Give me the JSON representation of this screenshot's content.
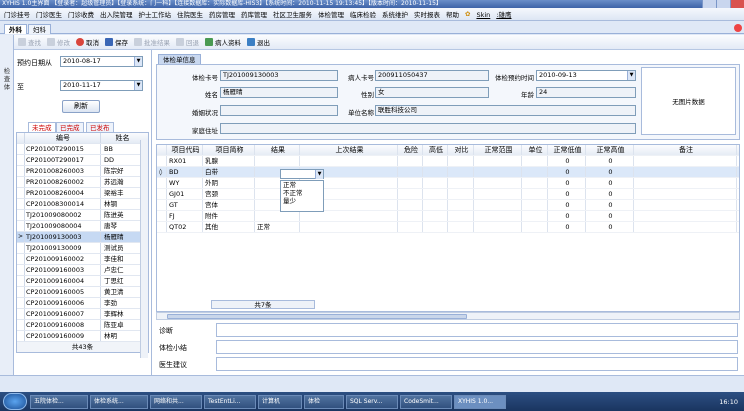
{
  "window": {
    "title": "XYHIS 1.0主界面 【登录者：超级管理员】【登录系统：门一科】【连接数据库：实际数据库-HIS3】【系统时间：2010-11-15 19:13:45】【版本时间：2010-11-15】"
  },
  "menu": [
    "门诊挂号",
    "门诊医生",
    "门诊收费",
    "出入院管理",
    "护士工作站",
    "住院医生",
    "药房管理",
    "药库管理",
    "社区卫生服务",
    "体检管理",
    "临床检验",
    "系统维护",
    "实时报表",
    "帮助",
    "Skin"
  ],
  "menu_skin_value": "雄鹰",
  "tabs": [
    "外科",
    "妇科"
  ],
  "toolbar": {
    "search": "查找",
    "modify": "修改",
    "cancel": "取消",
    "save": "保存",
    "batch": "批准结果",
    "back": "回退",
    "patient": "病人资料",
    "exit": "退出"
  },
  "sidebar_vertical": "检查体",
  "left": {
    "date_from_label": "预约日期从",
    "date_from": "2010-08-17",
    "date_to_label": "至",
    "date_to": "2010-11-17",
    "refresh": "刷新",
    "subtabs": [
      "未完成",
      "已完成",
      "已发布"
    ],
    "col_code": "编号",
    "col_name": "姓名",
    "rows": [
      [
        "CP20100T290015",
        "BB"
      ],
      [
        "CP20100T290017",
        "DD"
      ],
      [
        "PR201008260003",
        "陈宗好"
      ],
      [
        "PR201008260002",
        "苏远瀚"
      ],
      [
        "PR201008260004",
        "梁裕丰"
      ],
      [
        "CP201008300014",
        "林钢"
      ],
      [
        "TJ201009080002",
        "陈进英"
      ],
      [
        "TJ201009080004",
        "唐琴"
      ],
      [
        "TJ201009130003",
        "杨雁晴"
      ],
      [
        "TJ201009130009",
        "测试员"
      ],
      [
        "CP201009160002",
        "李佳和"
      ],
      [
        "CP201009160003",
        "卢忠仁"
      ],
      [
        "CP201009160004",
        "丁思红"
      ],
      [
        "CP201009160005",
        "黄卫清"
      ],
      [
        "CP201009160006",
        "李劲"
      ],
      [
        "CP201009160007",
        "李辉林"
      ],
      [
        "CP201009160008",
        "陈亚卓"
      ],
      [
        "CP201009160009",
        "林明"
      ]
    ],
    "selected_index": 8,
    "total": "共43条"
  },
  "info": {
    "tab": "体检单信息",
    "card_label": "体检卡号",
    "card": "TJ201009130003",
    "patient_no_label": "病人卡号",
    "patient_no": "200911050437",
    "appt_label": "体检预约时间",
    "appt": "2010-09-13",
    "name_label": "姓名",
    "name": "杨雁晴",
    "sex_label": "性别",
    "sex": "女",
    "age_label": "年龄",
    "age": "24",
    "marital_label": "婚姻状况",
    "marital": "",
    "unit_label": "单位名称",
    "unit": "联胜科技公司",
    "address_label": "家庭住址",
    "address": "",
    "photo": "无图片数据"
  },
  "detail": {
    "headers": [
      "项目代码",
      "项目简称",
      "结果",
      "上次结果",
      "危险",
      "高低",
      "对比",
      "正常范围",
      "单位",
      "正常低值",
      "正常高值",
      "备注"
    ],
    "rows": [
      [
        "RX01",
        "乳腺",
        "",
        "",
        "",
        "",
        "",
        "",
        "",
        "0",
        "0",
        ""
      ],
      [
        "BD",
        "白带",
        "",
        "",
        "",
        "",
        "",
        "",
        "",
        "0",
        "0",
        ""
      ],
      [
        "WY",
        "外阴",
        "",
        "",
        "",
        "",
        "",
        "",
        "",
        "0",
        "0",
        ""
      ],
      [
        "GJ01",
        "宫颈",
        "",
        "",
        "",
        "",
        "",
        "",
        "",
        "0",
        "0",
        ""
      ],
      [
        "GT",
        "宫体",
        "",
        "",
        "",
        "",
        "",
        "",
        "",
        "0",
        "0",
        ""
      ],
      [
        "FJ",
        "附件",
        "",
        "",
        "",
        "",
        "",
        "",
        "",
        "0",
        "0",
        ""
      ],
      [
        "QT02",
        "其他",
        "正常",
        "",
        "",
        "",
        "",
        "",
        "",
        "0",
        "0",
        ""
      ]
    ],
    "dropdown_options": [
      "正常",
      "不正常",
      "量少"
    ],
    "total": "共7条"
  },
  "bottom": {
    "diagnosis": "诊断",
    "summary": "体检小结",
    "advice": "医生建议"
  },
  "taskbar": {
    "items": [
      "五院体检...",
      "体检系统...",
      "网络和共...",
      "TestEntLi...",
      "计算机",
      "体检",
      "SQL Serv...",
      "CodeSmit...",
      "XYHIS 1.0..."
    ],
    "time": "16:10"
  }
}
